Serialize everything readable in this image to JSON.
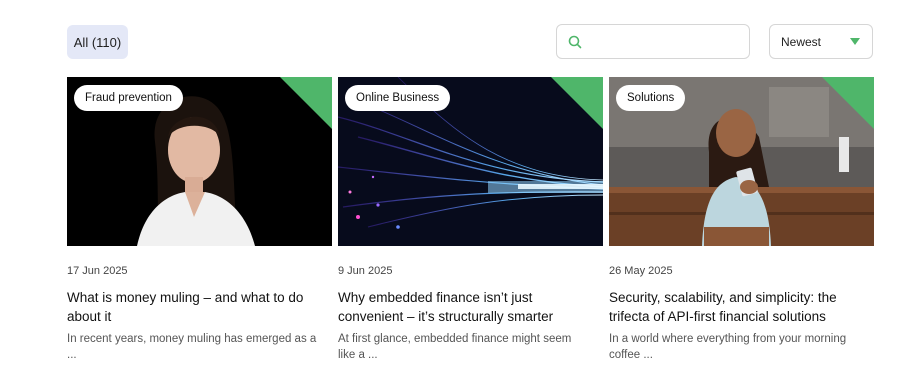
{
  "filter": {
    "all_label": "All (110)"
  },
  "search": {
    "placeholder": "",
    "value": ""
  },
  "sort": {
    "selected": "Newest"
  },
  "colors": {
    "accent_green": "#4fb66a",
    "chip_bg": "#e4e8f7"
  },
  "cards": [
    {
      "tag": "Fraud prevention",
      "date": "17 Jun 2025",
      "title": "What is money muling – and what to do about it",
      "excerpt": "In recent years, money muling has emerged as a ..."
    },
    {
      "tag": "Online Business",
      "date": "9 Jun 2025",
      "title": "Why embedded finance isn’t just convenient – it’s structurally smarter",
      "excerpt": "At first glance, embedded finance might seem like a ..."
    },
    {
      "tag": "Solutions",
      "date": "26 May 2025",
      "title": "Security, scalability, and simplicity: the trifecta of API-first financial solutions",
      "excerpt": "In a world where everything from your morning coffee ..."
    }
  ]
}
